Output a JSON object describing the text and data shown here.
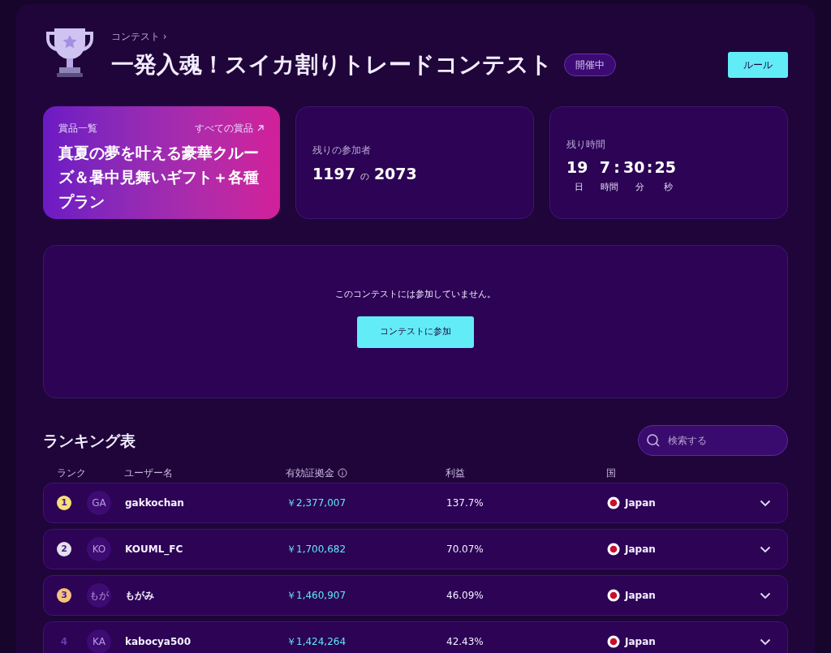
{
  "breadcrumb": "コンテスト ›",
  "title": "一発入魂！スイカ割りトレードコンテスト",
  "status_badge": "開催中",
  "rules_button": "ルール",
  "prize_card": {
    "label": "賞品一覧",
    "link": "すべての賞品",
    "text": "真夏の夢を叶える豪華クルーズ＆暑中見舞いギフト＋各種プラン"
  },
  "participants_card": {
    "label": "残りの参加者",
    "remaining": "1197",
    "of": "の",
    "total": "2073"
  },
  "time_card": {
    "label": "残り時間",
    "days": "19",
    "hours": "7",
    "sep1": ":",
    "minutes": "30",
    "sep2": ":",
    "seconds": "25",
    "units": [
      "日",
      "時間",
      "分",
      "秒"
    ]
  },
  "join_panel": {
    "message": "このコンテストには参加していません。",
    "button": "コンテストに参加"
  },
  "ranking": {
    "title": "ランキング表",
    "search_placeholder": "検索する",
    "columns": [
      "ランク",
      "ユーザー名",
      "有効証拠金",
      "利益",
      "国"
    ],
    "rows": [
      {
        "rank": "1",
        "color": "#f8e07a",
        "avatar": "GA",
        "user": "gakkochan",
        "equity": "￥2,377,007",
        "profit": "137.7%",
        "country": "Japan"
      },
      {
        "rank": "2",
        "color": "#e4e0ee",
        "avatar": "KO",
        "user": "KOUML_FC",
        "equity": "￥1,700,682",
        "profit": "70.07%",
        "country": "Japan"
      },
      {
        "rank": "3",
        "color": "#f6c27e",
        "avatar": "もが",
        "user": "もがみ",
        "equity": "￥1,460,907",
        "profit": "46.09%",
        "country": "Japan"
      },
      {
        "rank": "4",
        "avatar": "KA",
        "user": "kabocya500",
        "equity": "￥1,424,264",
        "profit": "42.43%",
        "country": "Japan"
      }
    ]
  }
}
